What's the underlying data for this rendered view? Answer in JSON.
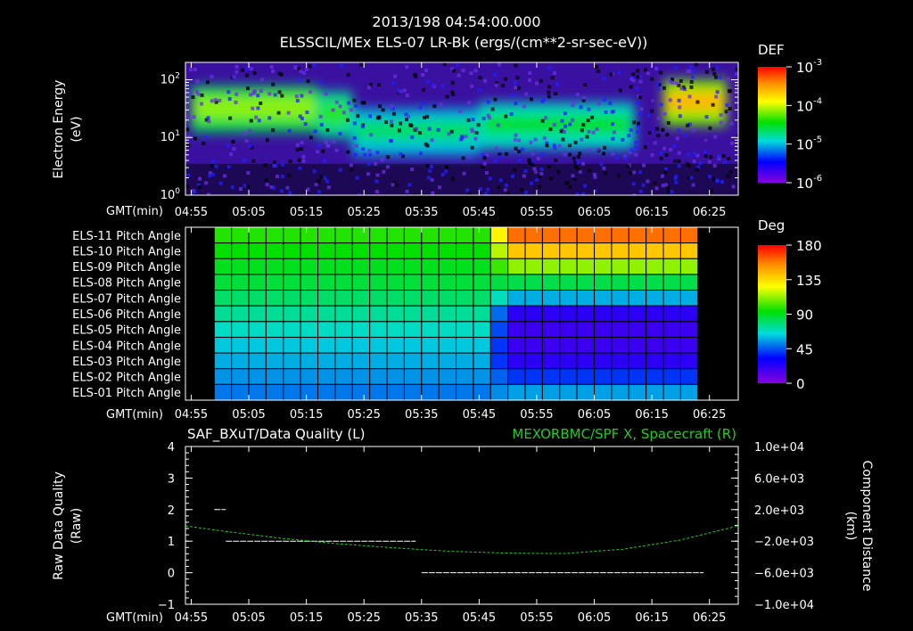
{
  "header": {
    "timestamp": "2013/198 04:54:00.000",
    "instrument": "ELSSCIL/MEx ELS-07 LR-Bk  (ergs/(cm**2-sr-sec-eV))"
  },
  "chart_data": [
    {
      "type": "heatmap",
      "name": "energy-spectrogram",
      "ylabel": "Electron Energy",
      "yunit": "(eV)",
      "ylim": [
        1,
        200
      ],
      "yscale": "log",
      "ytick_labels": [
        {
          "v": 1,
          "base": "10",
          "exp": "0"
        },
        {
          "v": 10,
          "base": "10",
          "exp": "1"
        },
        {
          "v": 100,
          "base": "10",
          "exp": "2"
        }
      ],
      "xlabel": "GMT(min)",
      "x_tick_labels": [
        "04:55",
        "05:05",
        "05:15",
        "05:25",
        "05:35",
        "05:45",
        "05:55",
        "06:05",
        "06:15",
        "06:25"
      ],
      "x_tick_minutes": [
        295,
        305,
        315,
        325,
        335,
        345,
        355,
        365,
        375,
        385
      ],
      "xlim_minutes": [
        294,
        390
      ],
      "colorbar": {
        "title": "DEF",
        "scale": "log",
        "range": [
          1e-06,
          0.001
        ],
        "tick_labels": [
          {
            "v": -3,
            "base": "10",
            "exp": "-3"
          },
          {
            "v": -4,
            "base": "10",
            "exp": "-4"
          },
          {
            "v": -5,
            "base": "10",
            "exp": "-5"
          },
          {
            "v": -6,
            "base": "10",
            "exp": "-6"
          }
        ]
      },
      "bands": [
        {
          "t0": 295,
          "t1": 317,
          "e_center": 35,
          "level": 0.62
        },
        {
          "t0": 317,
          "t1": 323,
          "e_center": 28,
          "level": 0.55
        },
        {
          "t0": 323,
          "t1": 345,
          "e_center": 14,
          "level": 0.45
        },
        {
          "t0": 345,
          "t1": 372,
          "e_center": 18,
          "level": 0.5
        },
        {
          "t0": 377,
          "t1": 388,
          "e_center": 45,
          "level": 0.8
        }
      ]
    },
    {
      "type": "heatmap",
      "name": "pitch-angle-grid",
      "rows": [
        "ELS-11 Pitch Angle",
        "ELS-10 Pitch Angle",
        "ELS-09 Pitch Angle",
        "ELS-08 Pitch Angle",
        "ELS-07 Pitch Angle",
        "ELS-06 Pitch Angle",
        "ELS-05 Pitch Angle",
        "ELS-04 Pitch Angle",
        "ELS-03 Pitch Angle",
        "ELS-02 Pitch Angle",
        "ELS-01 Pitch Angle"
      ],
      "xlabel": "GMT(min)",
      "x_tick_labels": [
        "04:55",
        "05:05",
        "05:15",
        "05:25",
        "05:35",
        "05:45",
        "05:55",
        "06:05",
        "06:15",
        "06:25"
      ],
      "x_tick_minutes": [
        295,
        305,
        315,
        325,
        335,
        345,
        355,
        365,
        375,
        385
      ],
      "xlim_minutes": [
        294,
        390
      ],
      "data_t_range": [
        299,
        383
      ],
      "columns": 28,
      "transition_minutes": [
        346,
        351
      ],
      "angles_before_deg": [
        98,
        94,
        90,
        86,
        80,
        74,
        68,
        62,
        58,
        54,
        50
      ],
      "angles_after_deg": [
        160,
        140,
        112,
        84,
        58,
        22,
        18,
        18,
        22,
        40,
        56
      ],
      "colorbar": {
        "title": "Deg",
        "range": [
          0,
          180
        ],
        "tick_labels": [
          "180",
          "135",
          "90",
          "45",
          "0"
        ],
        "tick_values": [
          180,
          135,
          90,
          45,
          0
        ]
      }
    },
    {
      "type": "line",
      "name": "quality-and-position",
      "left_title": "SAF_BXuT/Data Quality (L)",
      "right_title": "MEXORBMC/SPF X, Spacecraft (R)",
      "ylabel_left": "Raw Data Quality",
      "ylabel_left_unit": "(Raw)",
      "ylabel_right": "Component Distance",
      "ylabel_right_unit": "(km)",
      "ylim_left": [
        -1,
        4
      ],
      "ylim_right": [
        -10000,
        10000
      ],
      "left_tick_labels": [
        "4",
        "3",
        "2",
        "1",
        "0",
        "−1"
      ],
      "left_tick_values": [
        4,
        3,
        2,
        1,
        0,
        -1
      ],
      "right_tick_labels": [
        "1.0e+04",
        "6.0e+03",
        "2.0e+03",
        "−2.0e+03",
        "−6.0e+03",
        "−1.0e+04"
      ],
      "right_tick_values": [
        10000,
        6000,
        2000,
        -2000,
        -6000,
        -10000
      ],
      "xlabel": "GMT(min)",
      "x_tick_labels": [
        "04:55",
        "05:05",
        "05:15",
        "05:25",
        "05:35",
        "05:45",
        "05:55",
        "06:05",
        "06:15",
        "06:25"
      ],
      "x_tick_minutes": [
        295,
        305,
        315,
        325,
        335,
        345,
        355,
        365,
        375,
        385
      ],
      "xlim_minutes": [
        294,
        390
      ],
      "series": [
        {
          "axis": "left",
          "color": "#ffffff",
          "style": "dash",
          "segments": [
            [
              [
                299,
                2
              ],
              [
                301,
                2
              ]
            ],
            [
              [
                301,
                1
              ],
              [
                334,
                1
              ]
            ],
            [
              [
                335,
                0
              ],
              [
                384,
                0
              ]
            ]
          ]
        },
        {
          "axis": "right",
          "color": "#22cc22",
          "style": "dash",
          "points": [
            [
              294,
              -51
            ],
            [
              300,
              -681
            ],
            [
              310,
              -1581
            ],
            [
              320,
              -2301
            ],
            [
              330,
              -2841
            ],
            [
              340,
              -3291
            ],
            [
              350,
              -3516
            ],
            [
              356,
              -3561
            ],
            [
              360,
              -3561
            ],
            [
              370,
              -3021
            ],
            [
              380,
              -1851
            ],
            [
              390,
              -51
            ]
          ]
        }
      ]
    }
  ]
}
